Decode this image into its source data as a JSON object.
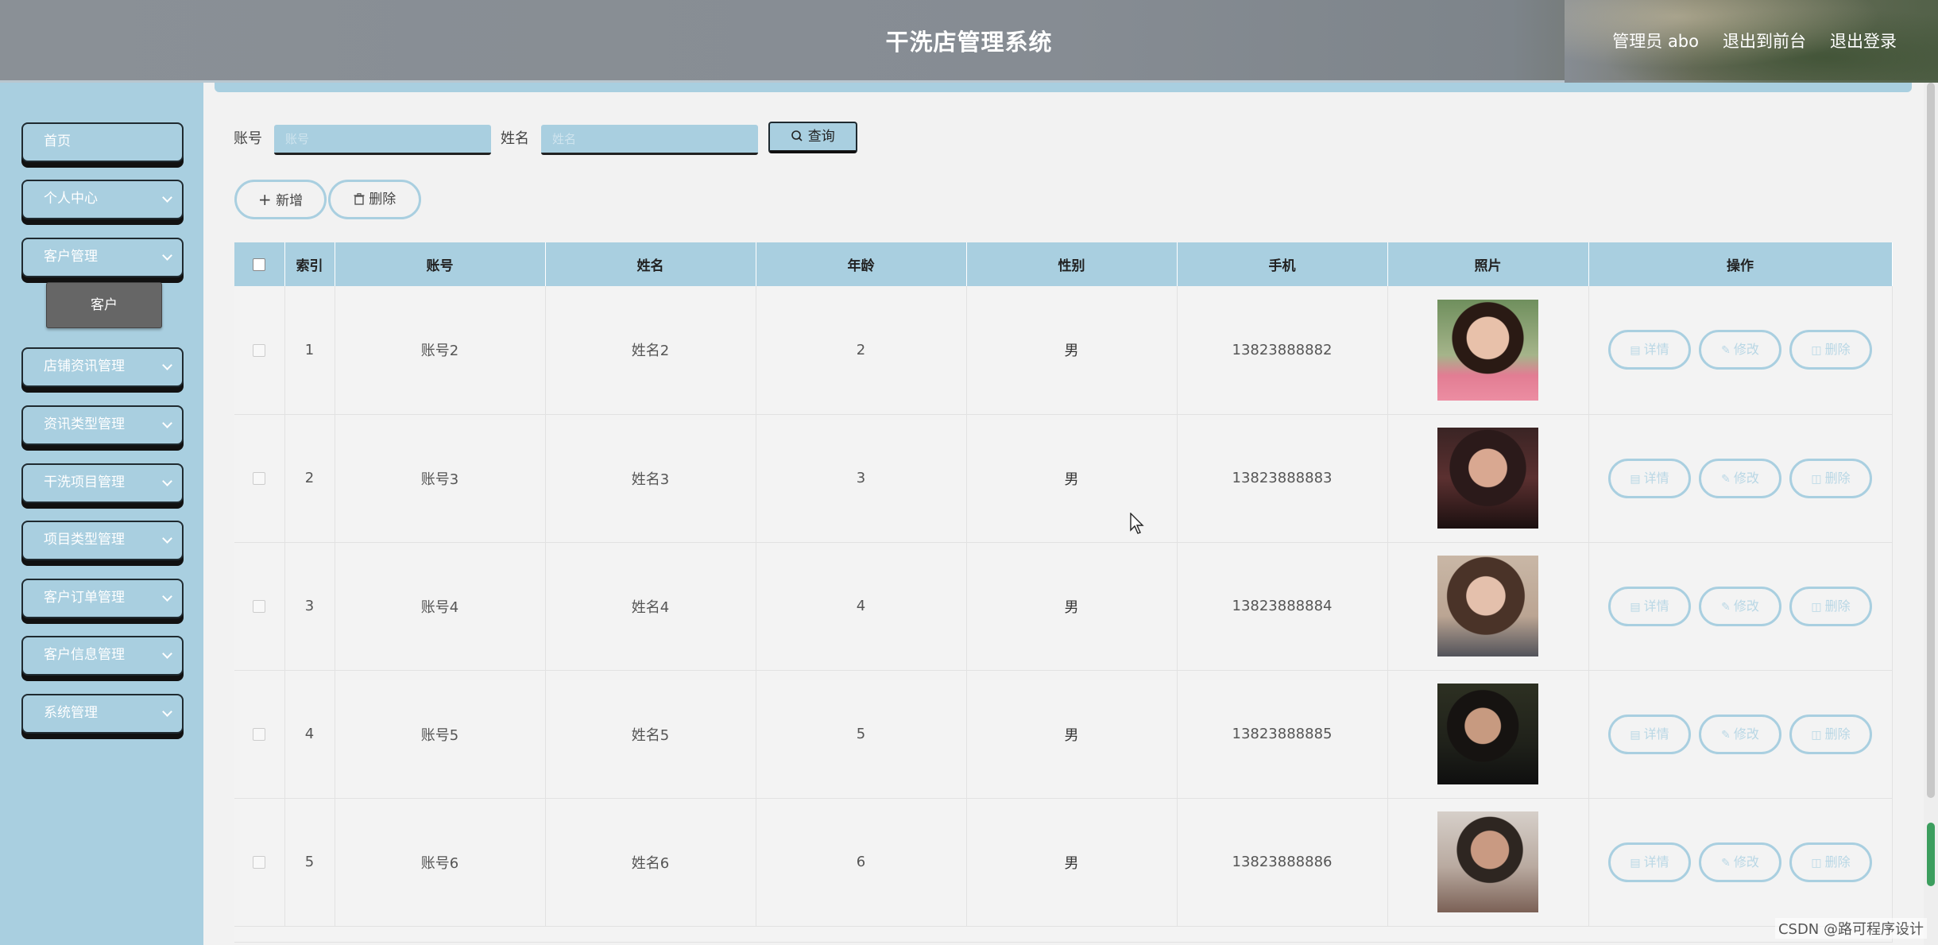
{
  "header": {
    "title": "干洗店管理系统",
    "admin_label": "管理员 abo",
    "exit_front_label": "退出到前台",
    "logout_label": "退出登录"
  },
  "sidebar": {
    "items": [
      {
        "label": "首页",
        "has_chevron": false
      },
      {
        "label": "个人中心",
        "has_chevron": true
      },
      {
        "label": "客户管理",
        "has_chevron": true
      },
      {
        "label": "店铺资讯管理",
        "has_chevron": true
      },
      {
        "label": "资讯类型管理",
        "has_chevron": true
      },
      {
        "label": "干洗项目管理",
        "has_chevron": true
      },
      {
        "label": "项目类型管理",
        "has_chevron": true
      },
      {
        "label": "客户订单管理",
        "has_chevron": true
      },
      {
        "label": "客户信息管理",
        "has_chevron": true
      },
      {
        "label": "系统管理",
        "has_chevron": true
      }
    ],
    "active_sub": "客户"
  },
  "search": {
    "account_label": "账号",
    "account_placeholder": "账号",
    "name_label": "姓名",
    "name_placeholder": "姓名",
    "query_label": "查询"
  },
  "toolbar": {
    "add_label": "新增",
    "delete_label": "删除"
  },
  "table": {
    "headers": [
      "索引",
      "账号",
      "姓名",
      "年龄",
      "性别",
      "手机",
      "照片",
      "操作"
    ],
    "actions": {
      "detail": "详情",
      "edit": "修改",
      "delete": "删除"
    },
    "rows": [
      {
        "index": "1",
        "account": "账号2",
        "name": "姓名2",
        "age": "2",
        "gender": "男",
        "phone": "13823888882"
      },
      {
        "index": "2",
        "account": "账号3",
        "name": "姓名3",
        "age": "3",
        "gender": "男",
        "phone": "13823888883"
      },
      {
        "index": "3",
        "account": "账号4",
        "name": "姓名4",
        "age": "4",
        "gender": "男",
        "phone": "13823888884"
      },
      {
        "index": "4",
        "account": "账号5",
        "name": "姓名5",
        "age": "5",
        "gender": "男",
        "phone": "13823888885"
      },
      {
        "index": "5",
        "account": "账号6",
        "name": "姓名6",
        "age": "6",
        "gender": "男",
        "phone": "13823888886"
      }
    ]
  },
  "watermark": "CSDN @路可程序设计",
  "colors": {
    "accent": "#a9cfe0",
    "header_bg": "#868c93",
    "sub_active_bg": "#666666"
  }
}
